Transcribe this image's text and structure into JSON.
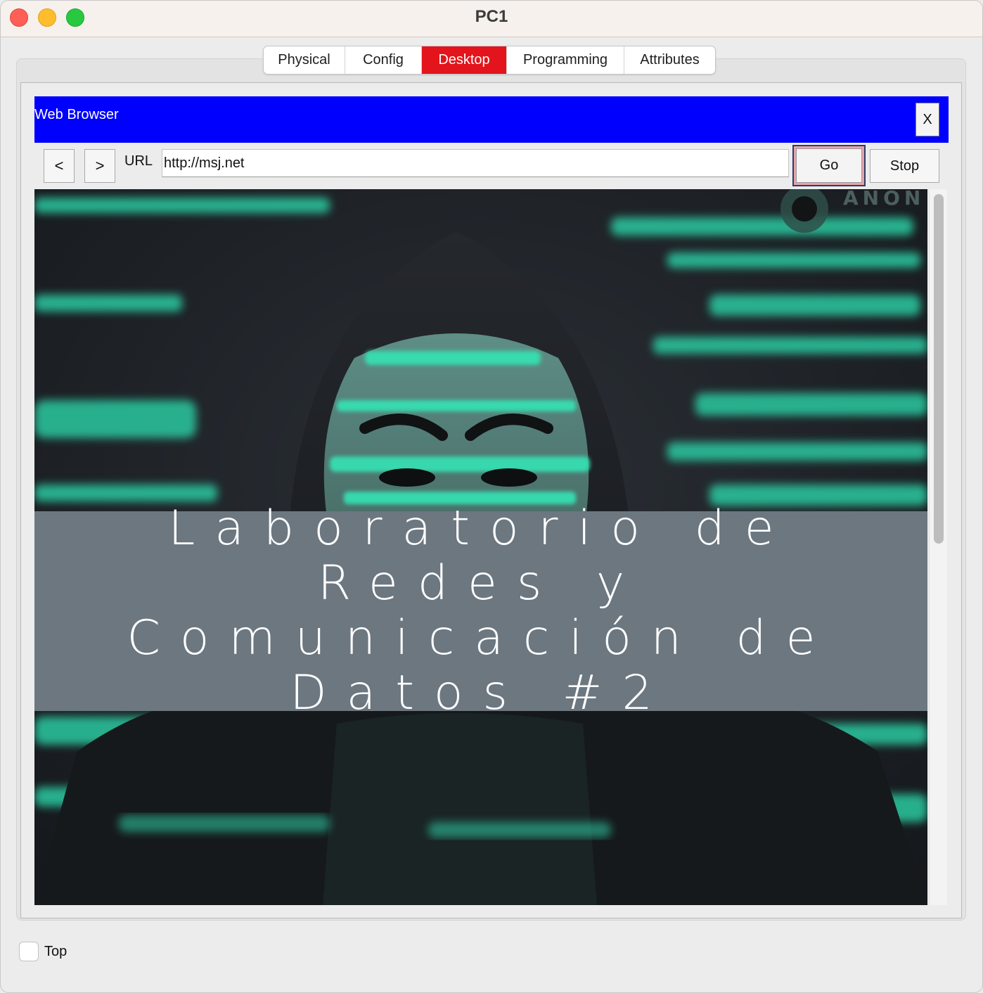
{
  "window": {
    "title": "PC1"
  },
  "tabs": [
    {
      "label": "Physical",
      "active": false
    },
    {
      "label": "Config",
      "active": false
    },
    {
      "label": "Desktop",
      "active": true
    },
    {
      "label": "Programming",
      "active": false
    },
    {
      "label": "Attributes",
      "active": false
    }
  ],
  "browser": {
    "title": "Web Browser",
    "close_label": "X",
    "back_label": "<",
    "forward_label": ">",
    "url_label": "URL",
    "url_value": "http://msj.net",
    "go_label": "Go",
    "stop_label": "Stop"
  },
  "page": {
    "banner_line1": "Laboratorio de Redes y Comunicación de Datos #2",
    "image_corner_text": "ANON"
  },
  "footer": {
    "checkbox_label": "Top",
    "checked": false
  },
  "colors": {
    "active_tab": "#e3141b",
    "browser_bar": "#0000ff",
    "banner": "#6c7780",
    "go_highlight": "#e8a3ab"
  }
}
